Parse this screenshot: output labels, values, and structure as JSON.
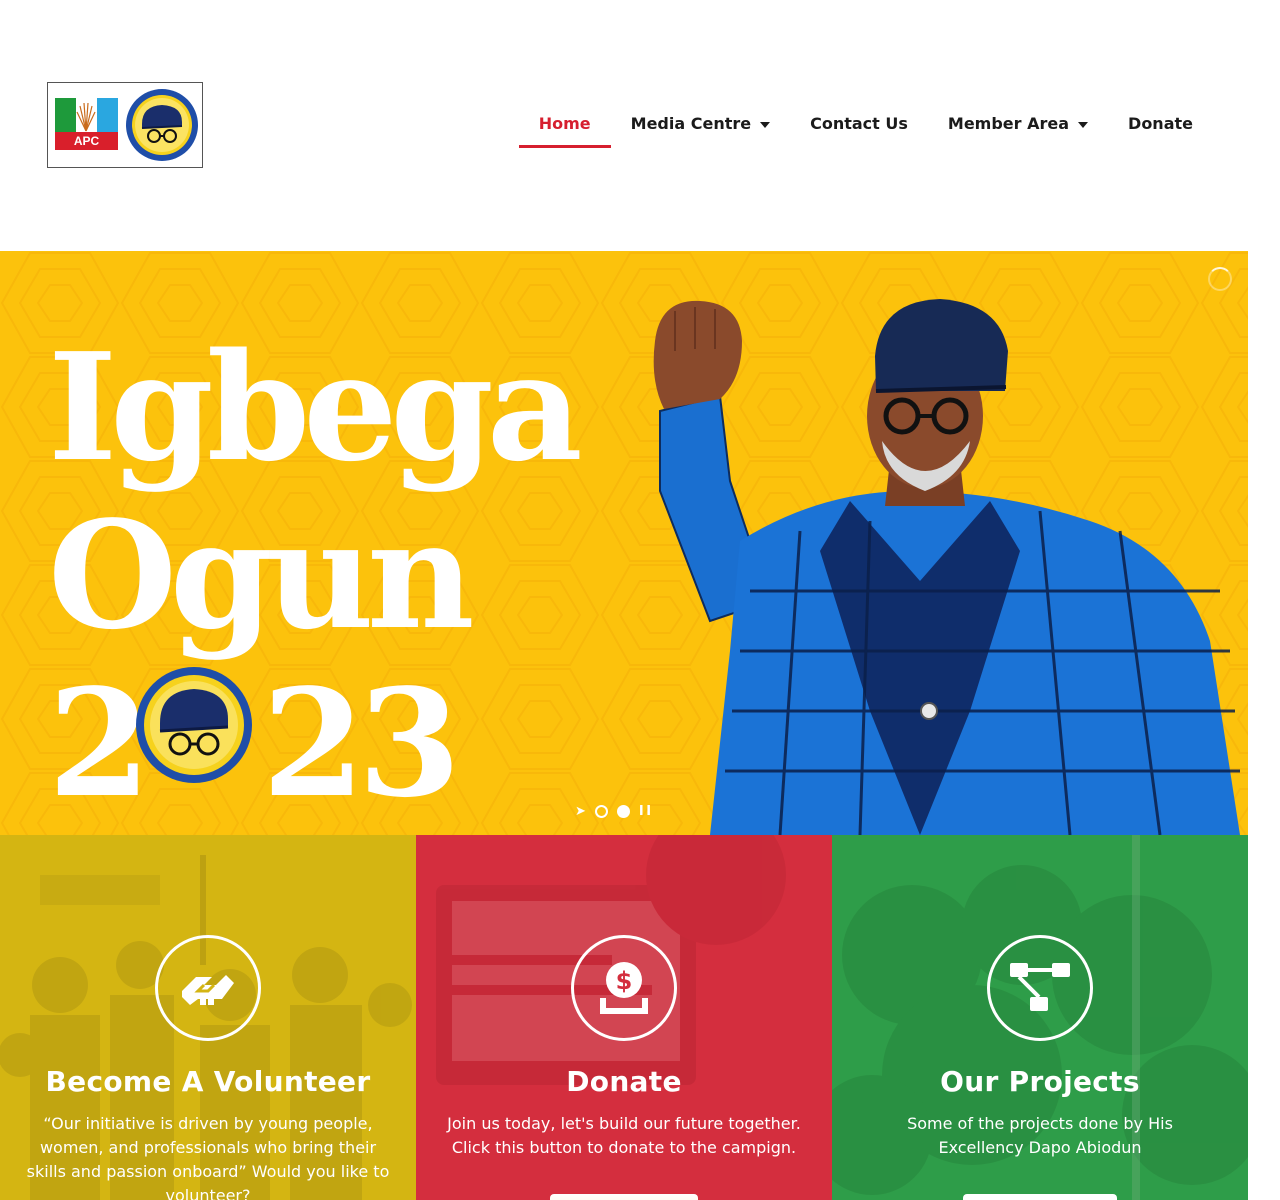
{
  "logo": {
    "party_label": "APC",
    "colors": {
      "green": "#1e9a3b",
      "white": "#ffffff",
      "blue": "#2aa7e0",
      "red": "#d91f2b",
      "badge_blue": "#1f4ea8",
      "badge_yellow": "#f6d21d"
    }
  },
  "nav": {
    "items": [
      {
        "label": "Home",
        "active": true,
        "dropdown": false
      },
      {
        "label": "Media Centre",
        "active": false,
        "dropdown": true
      },
      {
        "label": "Contact Us",
        "active": false,
        "dropdown": false
      },
      {
        "label": "Member Area",
        "active": false,
        "dropdown": true
      },
      {
        "label": "Donate",
        "active": false,
        "dropdown": false
      }
    ],
    "active_color": "#d61f2f"
  },
  "hero": {
    "title_line1": "Igbega",
    "title_line2": "Ogun",
    "year_prefix": "2",
    "year_suffix": "23",
    "background": "#fcc20c",
    "slider": {
      "slides": 2,
      "active_slide": 2,
      "prev_icon": "play-icon",
      "pause_icon": "pause-icon"
    }
  },
  "cards": [
    {
      "icon": "handshake-icon",
      "title": "Become A Volunteer",
      "text": "“Our initiative is driven by young people, women, and professionals who bring their skills and passion onboard” Would you like to volunteer?",
      "color": "#d4b513"
    },
    {
      "icon": "donate-icon",
      "title": "Donate",
      "text": "Join us today, let's build our future together. Click this button to donate to the campign.",
      "color": "#d42e3e"
    },
    {
      "icon": "sitemap-icon",
      "title": "Our Projects",
      "text": "Some of the projects done by His Excellency Dapo Abiodun",
      "color": "#2f9d49"
    }
  ]
}
